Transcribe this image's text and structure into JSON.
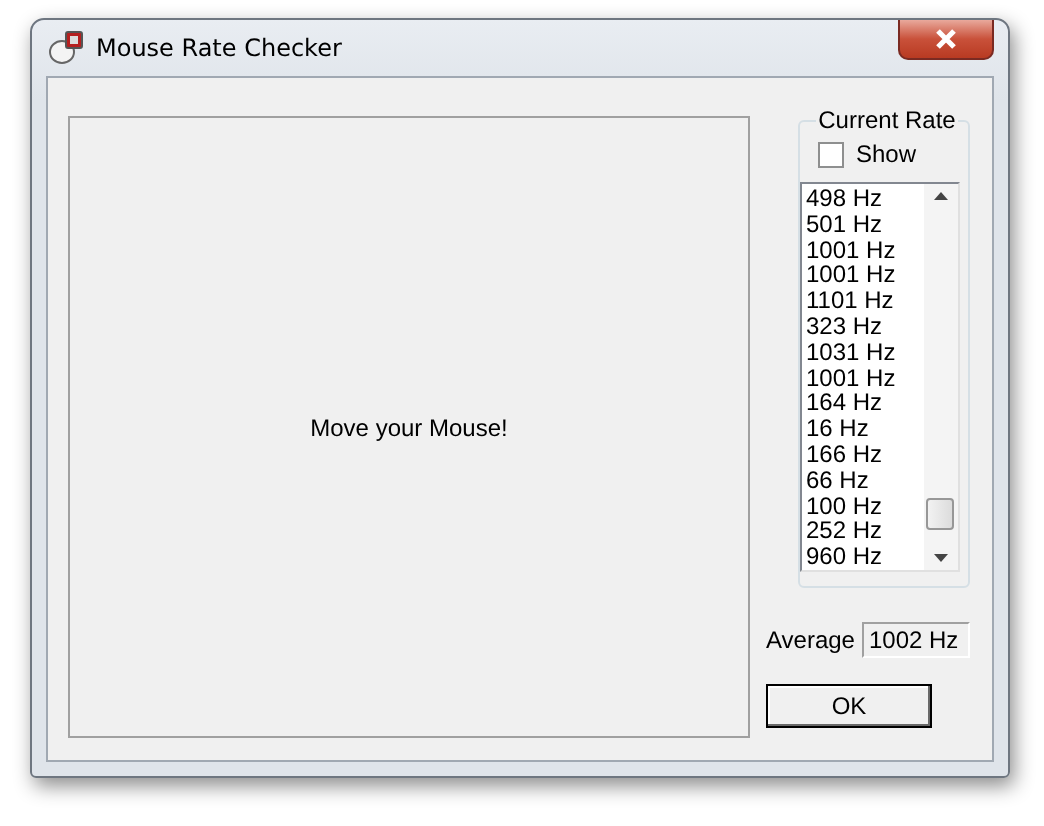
{
  "window": {
    "title": "Mouse Rate Checker"
  },
  "canvas": {
    "prompt": "Move your Mouse!"
  },
  "current_rate": {
    "label": "Current Rate",
    "show": {
      "label": "Show",
      "checked": false
    },
    "rates": [
      "498 Hz",
      "501 Hz",
      "1001 Hz",
      "1001 Hz",
      "1101 Hz",
      "323 Hz",
      "1031 Hz",
      "1001 Hz",
      "164 Hz",
      "16 Hz",
      "166 Hz",
      "66 Hz",
      "100 Hz",
      "252 Hz",
      "960 Hz"
    ]
  },
  "average": {
    "label": "Average",
    "value": "1002 Hz"
  },
  "buttons": [
    "OK"
  ]
}
